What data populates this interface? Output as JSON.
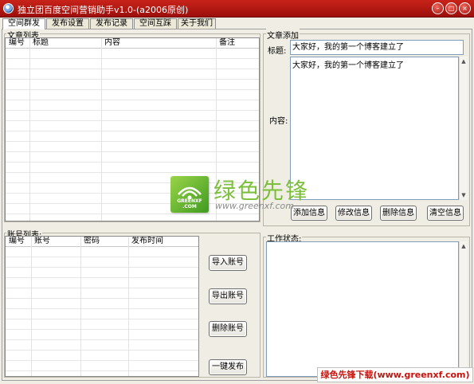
{
  "window": {
    "title": "独立团百度空间营销助手v1.0-(a2006原创)",
    "min_glyph": "–",
    "max_glyph": "□",
    "close_glyph": "×"
  },
  "tabs": [
    {
      "label": "空间群发",
      "active": true
    },
    {
      "label": "发布设置",
      "active": false
    },
    {
      "label": "发布记录",
      "active": false
    },
    {
      "label": "空间互踩",
      "active": false
    },
    {
      "label": "关于我们",
      "active": false
    }
  ],
  "articles": {
    "group_label": "文章列表",
    "columns": [
      "编号",
      "标题",
      "内容",
      "备注"
    ]
  },
  "article_add": {
    "group_label": "文章添加",
    "title_label": "标题:",
    "title_value": "大家好，我的第一个博客建立了",
    "content_label": "内容:",
    "content_value": "大家好，我的第一个博客建立了",
    "buttons": {
      "add": "添加信息",
      "edit": "修改信息",
      "delete": "删除信息",
      "clear": "清空信息"
    }
  },
  "accounts": {
    "group_label": "账号列表:",
    "columns": [
      "编号",
      "账号",
      "密码",
      "发布时间"
    ],
    "buttons": {
      "import": "导入账号",
      "export": "导出账号",
      "delete": "删除账号",
      "publish": "一键发布"
    }
  },
  "status": {
    "group_label": "工作状态:"
  },
  "watermark": {
    "logo_text": "GREENXF .COM",
    "name": "绿色先锋",
    "url": "www.greenxf.com",
    "banner": "绿色先锋下载(www.greenxf.com)"
  },
  "colors": {
    "titlebar": "#b51a12",
    "brand_green": "#7cbf3b",
    "banner_red": "#c8120b"
  }
}
